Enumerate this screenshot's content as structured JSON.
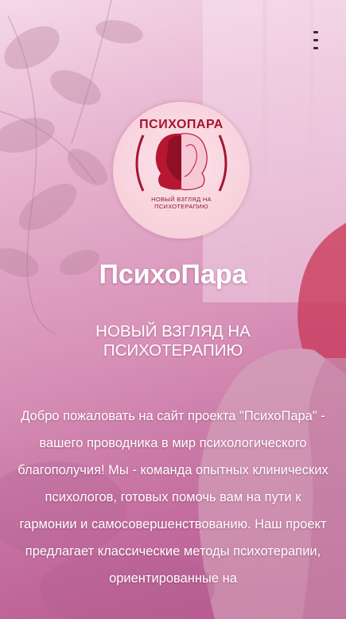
{
  "header": {
    "menu_icon": "kebab-menu-icon"
  },
  "logo": {
    "title": "ПСИХОПАРА",
    "subtitle_line1": "НОВЫЙ ВЗГЛЯД НА",
    "subtitle_line2": "ПСИХОТЕРАПИЮ",
    "icon": "two-faces-silhouette-icon",
    "colors": {
      "accent": "#a8142f",
      "background": "#f7d1dc"
    }
  },
  "hero": {
    "title": "ПсихоПара",
    "subtitle": "НОВЫЙ ВЗГЛЯД НА ПСИХОТЕРАПИЮ",
    "intro": "Добро пожаловать на сайт проекта \"ПсихоПара\" - вашего проводника в мир психологического благополучия! Мы - команда опытных клинических психологов, готовых помочь вам на пути к гармонии и самосовершенствованию. Наш проект предлагает классические методы психотерапии, ориентированные на"
  },
  "colors": {
    "text": "#ffffff",
    "background_start": "#f3d6e6",
    "background_end": "#b8588f"
  }
}
